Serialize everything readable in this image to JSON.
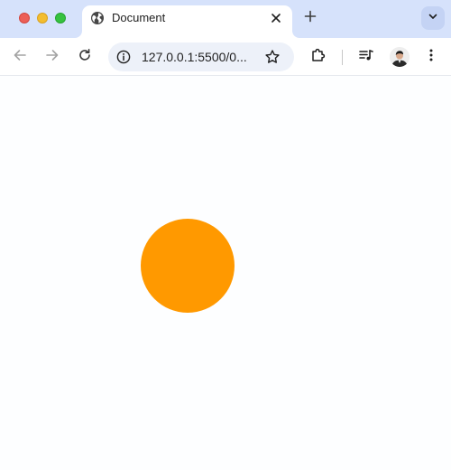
{
  "window": {
    "traffic_lights": {
      "close": "#ec5f57",
      "minimize": "#f3bd2f",
      "maximize": "#36c23f"
    }
  },
  "tab": {
    "title": "Document",
    "favicon_icon": "globe-icon",
    "close_icon": "close-icon"
  },
  "tabstrip": {
    "new_tab_icon": "plus-icon",
    "tab_search_icon": "chevron-down-icon"
  },
  "toolbar": {
    "back_icon": "arrow-left-icon",
    "forward_icon": "arrow-right-icon",
    "reload_icon": "reload-icon",
    "extensions_icon": "puzzle-icon",
    "media_icon": "media-queue-icon",
    "menu_icon": "kebab-menu-icon"
  },
  "omnibox": {
    "url": "127.0.0.1:5500/0...",
    "info_icon": "info-icon",
    "bookmark_icon": "star-icon"
  },
  "page": {
    "background": "#fdfeff",
    "circle_color": "#ff9900"
  }
}
